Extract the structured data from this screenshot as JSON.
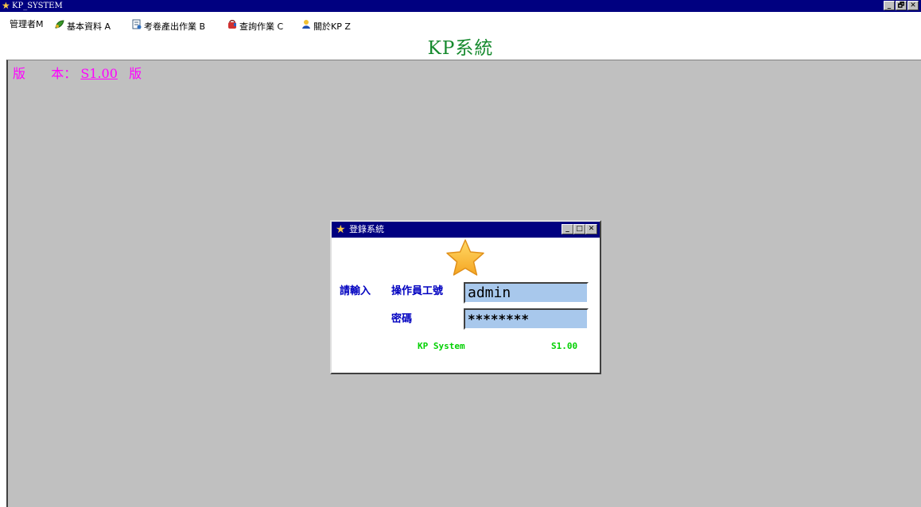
{
  "window": {
    "title": "KP_SYSTEM",
    "controls": {
      "minimize": "_",
      "restore": "🗗",
      "close": "✕"
    }
  },
  "menubar": {
    "items": [
      {
        "label": "管理者M",
        "icon": ""
      },
      {
        "label": "基本資料 A",
        "icon": "leaf-icon"
      },
      {
        "label": "考卷產出作業 B",
        "icon": "document-icon"
      },
      {
        "label": "查詢作業 C",
        "icon": "bag-icon"
      },
      {
        "label": "關於KP Z",
        "icon": "info-figure-icon"
      }
    ]
  },
  "app_heading": "KP系統",
  "version_bar": {
    "label_a": "版",
    "label_b": "本：",
    "value": "S1.00",
    "label_c": "版"
  },
  "login_dialog": {
    "title": "登錄系統",
    "prompt": "請輸入",
    "operator_label": "操作員工號",
    "operator_value": "admin",
    "password_label": "密碼",
    "password_value": "********",
    "footer_name": "KP System",
    "footer_version": "S1.00"
  },
  "colors": {
    "titlebar": "#000080",
    "workspace": "#c0c0c0",
    "heading": "#168a2e",
    "version": "#ff00ff",
    "label": "#0000c0",
    "input_bg": "#a8c8ec",
    "footer": "#00d000"
  }
}
